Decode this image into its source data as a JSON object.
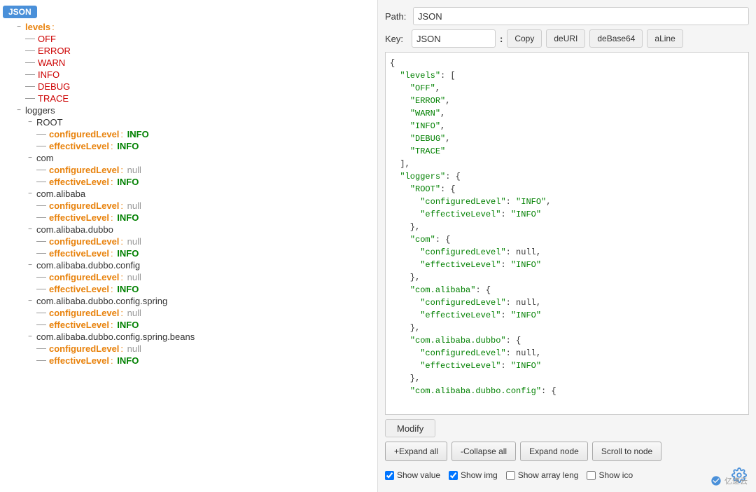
{
  "left_panel": {
    "root_badge": "JSON",
    "tree": [
      {
        "id": "levels",
        "label": "levels",
        "type": "key-orange",
        "suffix": " :",
        "indent": 1,
        "icon": "minus",
        "children": true
      },
      {
        "id": "OFF",
        "label": "OFF",
        "type": "key-red",
        "indent": 2,
        "icon": "dash"
      },
      {
        "id": "ERROR",
        "label": "ERROR",
        "type": "key-red",
        "indent": 2,
        "icon": "dash"
      },
      {
        "id": "WARN",
        "label": "WARN",
        "type": "key-red",
        "indent": 2,
        "icon": "dash"
      },
      {
        "id": "INFO",
        "label": "INFO",
        "type": "key-red",
        "indent": 2,
        "icon": "dash"
      },
      {
        "id": "DEBUG",
        "label": "DEBUG",
        "type": "key-red",
        "indent": 2,
        "icon": "dash"
      },
      {
        "id": "TRACE",
        "label": "TRACE",
        "type": "key-red",
        "indent": 2,
        "icon": "dash"
      },
      {
        "id": "loggers",
        "label": "loggers",
        "type": "node-label",
        "indent": 1,
        "icon": "minus",
        "children": true
      },
      {
        "id": "ROOT",
        "label": "ROOT",
        "type": "node-label",
        "indent": 2,
        "icon": "minus",
        "children": true
      },
      {
        "id": "configuredLevel1",
        "label": "configuredLevel",
        "type": "key-orange",
        "colon": " : ",
        "value": "INFO",
        "value_type": "value-green",
        "indent": 3,
        "icon": "dash"
      },
      {
        "id": "effectiveLevel1",
        "label": "effectiveLevel",
        "type": "key-orange",
        "colon": " : ",
        "value": "INFO",
        "value_type": "value-green",
        "indent": 3,
        "icon": "dash"
      },
      {
        "id": "com",
        "label": "com",
        "type": "node-label",
        "indent": 2,
        "icon": "minus",
        "children": true
      },
      {
        "id": "configuredLevel2",
        "label": "configuredLevel",
        "type": "key-orange",
        "colon": " : ",
        "value": "null",
        "value_type": "value-gray",
        "indent": 3,
        "icon": "dash"
      },
      {
        "id": "effectiveLevel2",
        "label": "effectiveLevel",
        "type": "key-orange",
        "colon": " : ",
        "value": "INFO",
        "value_type": "value-green",
        "indent": 3,
        "icon": "dash"
      },
      {
        "id": "com_alibaba",
        "label": "com.alibaba",
        "type": "node-label",
        "indent": 2,
        "icon": "minus",
        "children": true
      },
      {
        "id": "configuredLevel3",
        "label": "configuredLevel",
        "type": "key-orange",
        "colon": " : ",
        "value": "null",
        "value_type": "value-gray",
        "indent": 3,
        "icon": "dash"
      },
      {
        "id": "effectiveLevel3",
        "label": "effectiveLevel",
        "type": "key-orange",
        "colon": " : ",
        "value": "INFO",
        "value_type": "value-green",
        "indent": 3,
        "icon": "dash"
      },
      {
        "id": "com_alibaba_dubbo",
        "label": "com.alibaba.dubbo",
        "type": "node-label",
        "indent": 2,
        "icon": "minus",
        "children": true
      },
      {
        "id": "configuredLevel4",
        "label": "configuredLevel",
        "type": "key-orange",
        "colon": " : ",
        "value": "null",
        "value_type": "value-gray",
        "indent": 3,
        "icon": "dash"
      },
      {
        "id": "effectiveLevel4",
        "label": "effectiveLevel",
        "type": "key-orange",
        "colon": " : ",
        "value": "INFO",
        "value_type": "value-green",
        "indent": 3,
        "icon": "dash"
      },
      {
        "id": "com_alibaba_dubbo_config",
        "label": "com.alibaba.dubbo.config",
        "type": "node-label",
        "indent": 2,
        "icon": "minus",
        "children": true
      },
      {
        "id": "configuredLevel5",
        "label": "configuredLevel",
        "type": "key-orange",
        "colon": " : ",
        "value": "null",
        "value_type": "value-gray",
        "indent": 3,
        "icon": "dash"
      },
      {
        "id": "effectiveLevel5",
        "label": "effectiveLevel",
        "type": "key-orange",
        "colon": " : ",
        "value": "INFO",
        "value_type": "value-green",
        "indent": 3,
        "icon": "dash"
      },
      {
        "id": "com_alibaba_dubbo_config_spring",
        "label": "com.alibaba.dubbo.config.spring",
        "type": "node-label",
        "indent": 2,
        "icon": "minus",
        "children": true
      },
      {
        "id": "configuredLevel6",
        "label": "configuredLevel",
        "type": "key-orange",
        "colon": " : ",
        "value": "null",
        "value_type": "value-gray",
        "indent": 3,
        "icon": "dash"
      },
      {
        "id": "effectiveLevel6",
        "label": "effectiveLevel",
        "type": "key-orange",
        "colon": " : ",
        "value": "INFO",
        "value_type": "value-green",
        "indent": 3,
        "icon": "dash"
      },
      {
        "id": "com_alibaba_dubbo_config_spring_beans",
        "label": "com.alibaba.dubbo.config.spring.beans",
        "type": "node-label",
        "indent": 2,
        "icon": "minus",
        "children": true
      },
      {
        "id": "configuredLevel7",
        "label": "configuredLevel",
        "type": "key-orange",
        "colon": " : ",
        "value": "null",
        "value_type": "value-gray",
        "indent": 3,
        "icon": "dash"
      },
      {
        "id": "effectiveLevel7",
        "label": "effectiveLevel",
        "type": "key-orange",
        "colon": " : ",
        "value": "INFO",
        "value_type": "value-green",
        "indent": 3,
        "icon": "dash"
      }
    ]
  },
  "right_panel": {
    "path_label": "Path:",
    "path_value": "JSON",
    "key_label": "Key:",
    "key_value": "JSON",
    "colon_sep": ":",
    "buttons": {
      "copy": "Copy",
      "deuri": "deURI",
      "debase64": "deBase64",
      "aline": "aLine"
    },
    "json_content": "{\n  \"levels\": [\n    \"OFF\",\n    \"ERROR\",\n    \"WARN\",\n    \"INFO\",\n    \"DEBUG\",\n    \"TRACE\"\n  ],\n  \"loggers\": {\n    \"ROOT\": {\n      \"configuredLevel\": \"INFO\",\n      \"effectiveLevel\": \"INFO\"\n    },\n    \"com\": {\n      \"configuredLevel\": null,\n      \"effectiveLevel\": \"INFO\"\n    },\n    \"com.alibaba\": {\n      \"configuredLevel\": null,\n      \"effectiveLevel\": \"INFO\"\n    },\n    \"com.alibaba.dubbo\": {\n      \"configuredLevel\": null,\n      \"effectiveLevel\": \"INFO\"\n    },\n    \"com.alibaba.dubbo.config\": {",
    "modify_label": "Modify",
    "expand_all": "+Expand all",
    "collapse_all": "-Collapse all",
    "expand_node": "Expand node",
    "scroll_to_node": "Scroll to node",
    "checkboxes": [
      {
        "id": "show_value",
        "label": "Show value",
        "checked": true
      },
      {
        "id": "show_img",
        "label": "Show img",
        "checked": true
      },
      {
        "id": "show_array_leng",
        "label": "Show array leng",
        "checked": false
      },
      {
        "id": "show_ico",
        "label": "Show ico",
        "checked": false
      }
    ],
    "watermark": "亿速云"
  }
}
